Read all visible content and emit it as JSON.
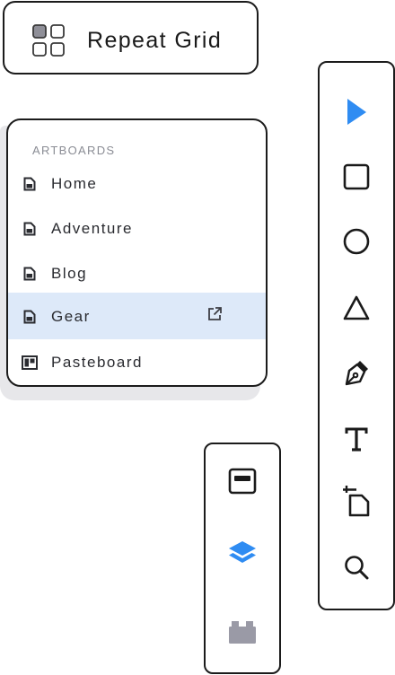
{
  "repeat_grid": {
    "label": "Repeat Grid",
    "icon": "repeat-grid-icon"
  },
  "artboards": {
    "heading": "ARTBOARDS",
    "items": [
      {
        "label": "Home",
        "icon": "artboard-icon",
        "selected": false
      },
      {
        "label": "Adventure",
        "icon": "artboard-icon",
        "selected": false
      },
      {
        "label": "Blog",
        "icon": "artboard-icon",
        "selected": false
      },
      {
        "label": "Gear",
        "icon": "artboard-icon",
        "selected": true,
        "action_icon": "external-link-icon"
      },
      {
        "label": "Pasteboard",
        "icon": "pasteboard-icon",
        "selected": false
      }
    ]
  },
  "tools": [
    {
      "name": "select-tool",
      "icon": "arrow-pointer-icon",
      "active": true
    },
    {
      "name": "rectangle-tool",
      "icon": "rectangle-icon",
      "active": false
    },
    {
      "name": "ellipse-tool",
      "icon": "ellipse-icon",
      "active": false
    },
    {
      "name": "triangle-tool",
      "icon": "triangle-icon",
      "active": false
    },
    {
      "name": "pen-tool",
      "icon": "pen-nib-icon",
      "active": false
    },
    {
      "name": "text-tool",
      "icon": "text-t-icon",
      "active": false
    },
    {
      "name": "artboard-tool",
      "icon": "artboard-crop-icon",
      "active": false
    },
    {
      "name": "zoom-tool",
      "icon": "magnifier-icon",
      "active": false
    }
  ],
  "panels": [
    {
      "name": "assets-panel",
      "icon": "assets-panel-icon",
      "active": false
    },
    {
      "name": "layers-panel",
      "icon": "layers-icon",
      "active": true
    },
    {
      "name": "plugins-panel",
      "icon": "plugin-brick-icon",
      "active": false
    }
  ],
  "colors": {
    "accent": "#2f8cf2",
    "selected_row": "#dde9f9",
    "muted": "#8a8c94",
    "disabled_icon": "#9a9aa6",
    "border": "#1b1b1b"
  }
}
